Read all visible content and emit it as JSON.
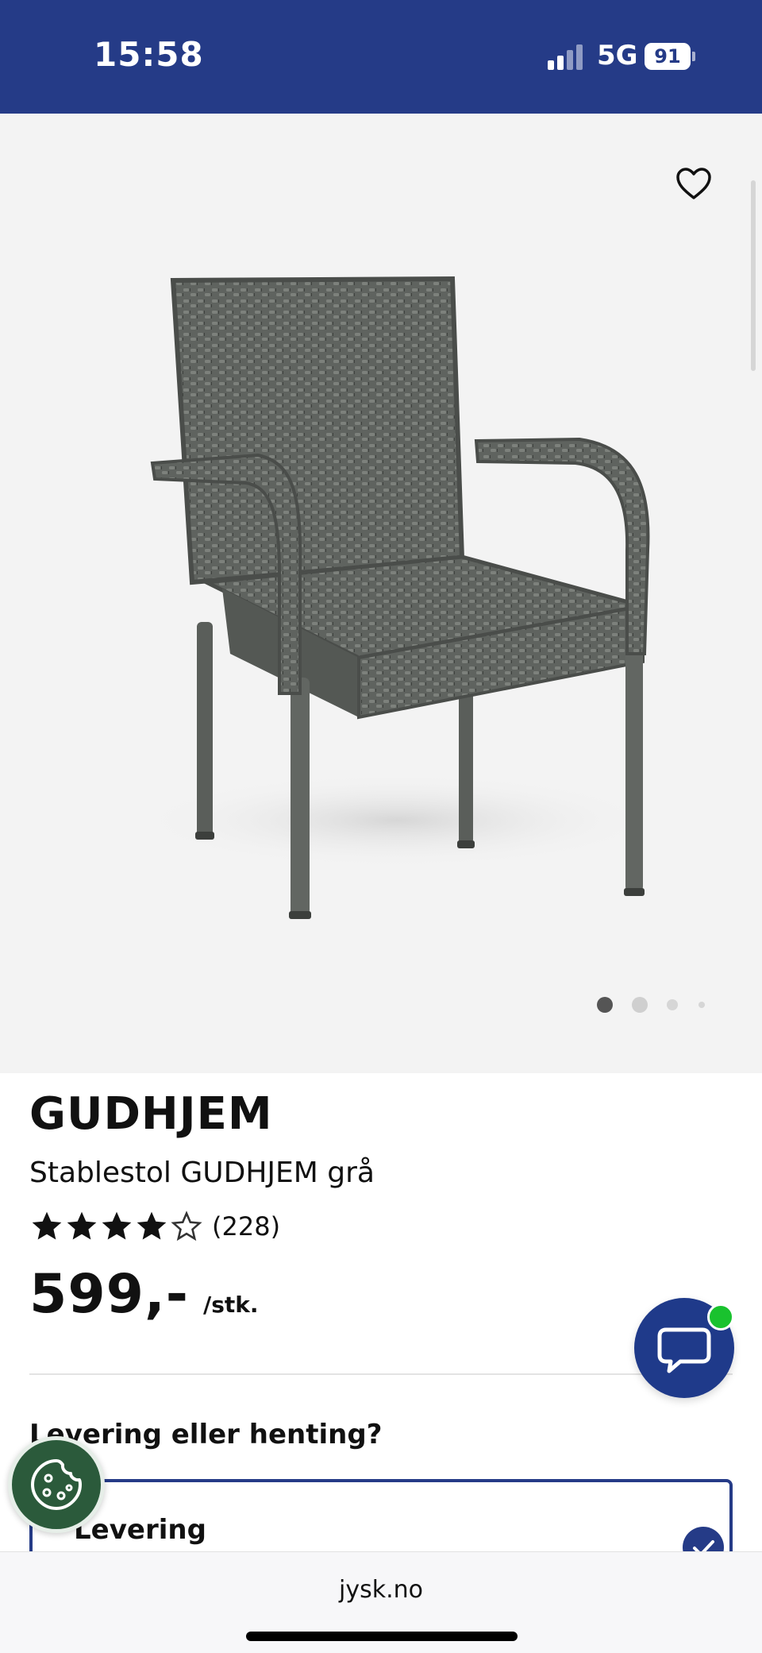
{
  "status_bar": {
    "time": "15:58",
    "network": "5G",
    "battery": "91"
  },
  "gallery": {
    "image_alt": "Stablestol GUDHJEM grå",
    "slide_count": 4,
    "active_slide": 1
  },
  "product": {
    "brand": "GUDHJEM",
    "subtitle": "Stablestol GUDHJEM grå",
    "rating": 4,
    "rating_max": 5,
    "review_count": "(228)",
    "price": "599,-",
    "unit": "/stk."
  },
  "delivery": {
    "heading": "Levering eller henting?",
    "option_label": "Levering"
  },
  "browser": {
    "url": "jysk.no"
  },
  "colors": {
    "brand_blue": "#253b87",
    "chat_online": "#19c22e",
    "cookie_green": "#2b5a3b"
  },
  "icons": {
    "wishlist": "heart-outline-icon",
    "chat": "speech-bubble-icon",
    "cookie": "cookie-icon",
    "check": "checkmark-icon"
  }
}
